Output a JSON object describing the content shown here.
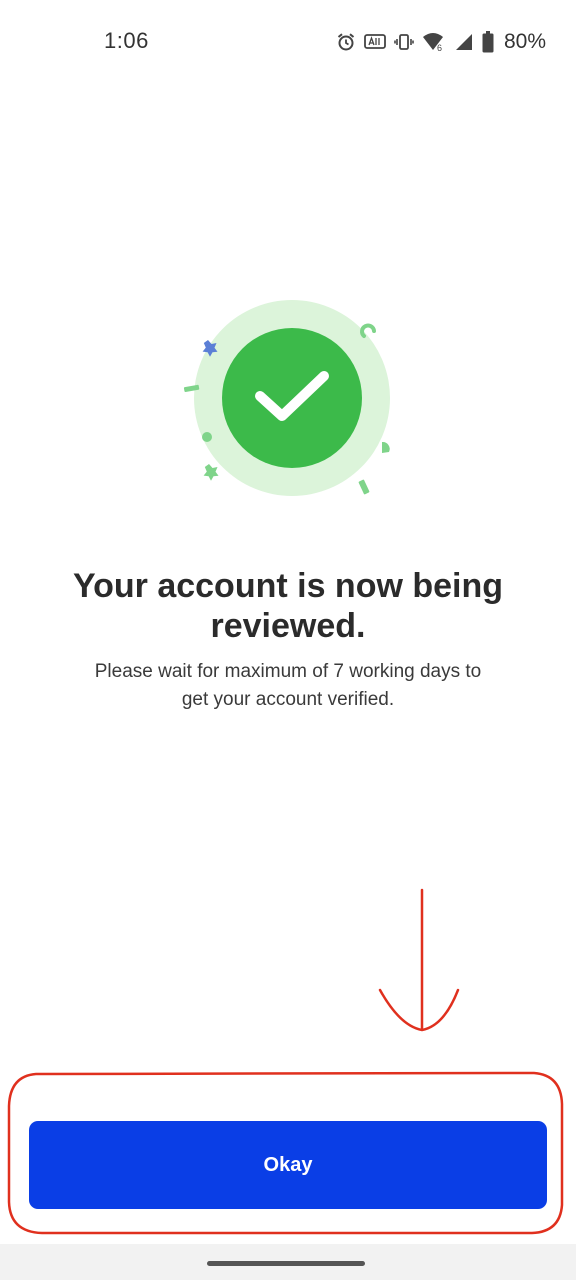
{
  "status_bar": {
    "time": "1:06",
    "battery_percent": "80%",
    "icons": [
      "alarm-icon",
      "auto-brightness-icon",
      "vibrate-icon",
      "wifi-6-icon",
      "cell-signal-icon",
      "battery-icon"
    ]
  },
  "illustration": {
    "icon": "check-icon",
    "colors": {
      "outer_circle": "#d9f3d7",
      "inner_circle": "#3cba4a",
      "check": "#ffffff",
      "confetti_green": "#7fd48a",
      "confetti_blue": "#5b7fd6"
    }
  },
  "message": {
    "headline": "Your account is now being reviewed.",
    "body": "Please wait for maximum of 7 working days to get your account verified."
  },
  "actions": {
    "okay_label": "Okay",
    "okay_color": "#0a3ee6"
  },
  "annotation": {
    "color": "#e0301e"
  }
}
